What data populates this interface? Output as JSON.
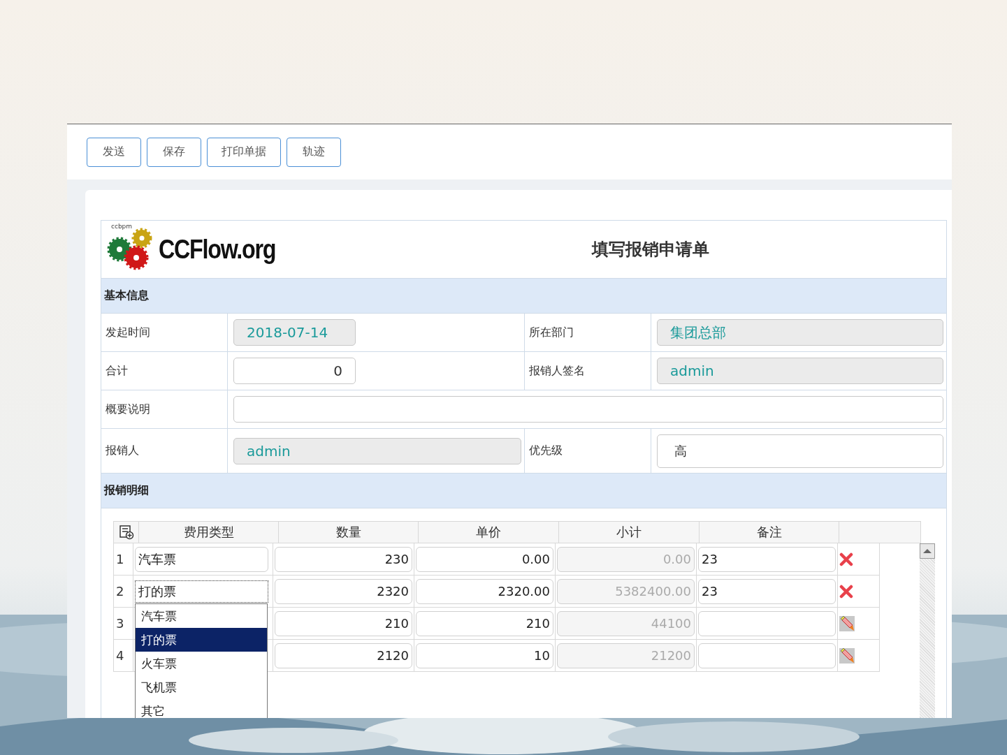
{
  "toolbar": {
    "buttons": [
      "发送",
      "保存",
      "打印单据",
      "轨迹"
    ]
  },
  "form": {
    "logo": {
      "caption": "ccbpm",
      "name": "CCFlow.org"
    },
    "title": "填写报销申请单",
    "basic_info": {
      "heading": "基本信息",
      "rows": [
        {
          "fields": [
            {
              "label": "发起时间",
              "value": "2018-07-14",
              "kind": "date",
              "readonly": true
            },
            {
              "label": "所在部门",
              "value": "集团总部",
              "kind": "text",
              "readonly": true
            }
          ]
        },
        {
          "fields": [
            {
              "label": "合计",
              "value": "0",
              "kind": "number",
              "readonly": false
            },
            {
              "label": "报销人签名",
              "value": "admin",
              "kind": "text",
              "readonly": true
            }
          ]
        },
        {
          "fields": [
            {
              "label": "概要说明",
              "kind": "text",
              "readonly": false
            }
          ]
        },
        {
          "fields": [
            {
              "label": "报销人",
              "value": "admin",
              "kind": "text",
              "readonly": true
            },
            {
              "label": "优先级",
              "value": "高",
              "kind": "select",
              "readonly": false
            }
          ]
        }
      ]
    },
    "details": {
      "heading": "报销明细",
      "columns": [
        "费用类型",
        "数量",
        "单价",
        "小计",
        "备注"
      ],
      "rows": [
        {
          "number": "1",
          "type": "汽车票",
          "quantity": "230",
          "price": "0.00",
          "subtotal": "0.00",
          "note": "23",
          "kind": "delete"
        },
        {
          "number": "2",
          "type": "打的票",
          "quantity": "2320",
          "price": "2320.00",
          "subtotal": "5382400.00",
          "note": "23",
          "kind": "delete",
          "type_dropdown": {
            "options": [
              {
                "label": "汽车票",
                "selected": false
              },
              {
                "label": "打的票",
                "selected": true
              },
              {
                "label": "火车票",
                "selected": false
              },
              {
                "label": "飞机票",
                "selected": false
              },
              {
                "label": "其它",
                "selected": false
              }
            ]
          }
        },
        {
          "number": "3",
          "quantity": "210",
          "price": "210",
          "subtotal": "44100",
          "kind": "edit"
        },
        {
          "number": "4",
          "quantity": "2120",
          "price": "10",
          "subtotal": "21200",
          "kind": "edit"
        }
      ]
    }
  }
}
